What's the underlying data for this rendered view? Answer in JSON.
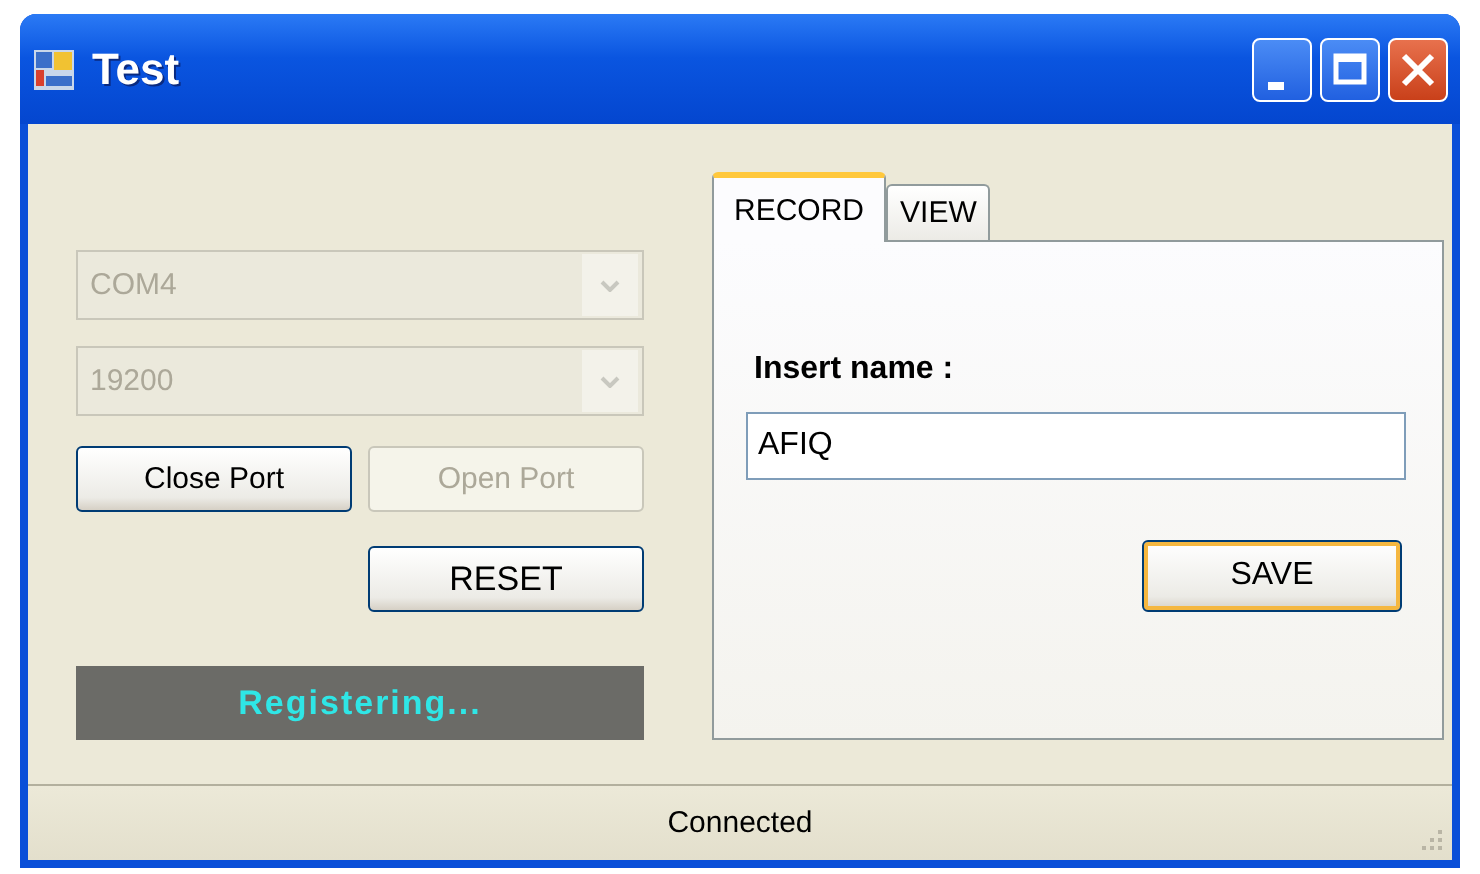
{
  "window": {
    "title": "Test"
  },
  "combos": [
    {
      "value": "COM4",
      "disabled": true
    },
    {
      "value": "19200",
      "disabled": true
    }
  ],
  "port_buttons": [
    {
      "label": "Close Port",
      "disabled": false
    },
    {
      "label": "Open Port",
      "disabled": true
    }
  ],
  "reset_button": {
    "label": "RESET"
  },
  "banner": {
    "text": "Registering..."
  },
  "tabs": [
    {
      "label": "RECORD",
      "selected": true
    },
    {
      "label": "VIEW",
      "selected": false
    }
  ],
  "form": {
    "label": "Insert name :",
    "value": "AFIQ",
    "save_button": "SAVE"
  },
  "status_bar": {
    "text": "Connected"
  }
}
